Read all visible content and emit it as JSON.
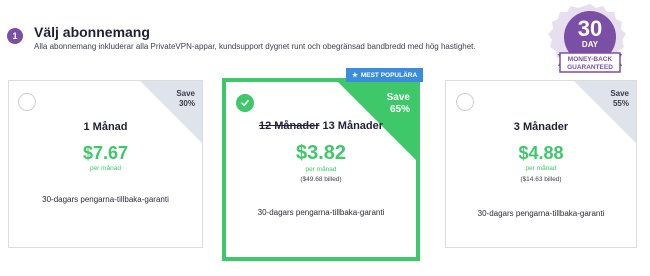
{
  "step": {
    "number": "1",
    "title": "Välj abonnemang",
    "subtitle": "Alla abonnemang inkluderar alla PrivateVPN-appar, kundsupport dygnet runt och obegränsad bandbredd med hög hastighet."
  },
  "seal": {
    "days": "30",
    "unit": "DAY",
    "line1": "MONEY-BACK",
    "line2": "GUARANTEED"
  },
  "popular_badge": "MEST POPULÄRA",
  "plans": [
    {
      "save_word": "Save",
      "save_pct": "30%",
      "old_name": "",
      "name": "1 Månad",
      "price": "$7.67",
      "per": "per månad",
      "billed": "",
      "guarantee": "30-dagars pengarna-tillbaka-garanti"
    },
    {
      "save_word": "Save",
      "save_pct": "65%",
      "old_name": "12 Månader",
      "name": "13 Månader",
      "price": "$3.82",
      "per": "per månad",
      "billed": "($49.68 billed)",
      "guarantee": "30-dagars pengarna-tillbaka-garanti"
    },
    {
      "save_word": "Save",
      "save_pct": "55%",
      "old_name": "",
      "name": "3 Månader",
      "price": "$4.88",
      "per": "per månad",
      "billed": "($14.63 billed)",
      "guarantee": "30-dagars pengarna-tillbaka-garanti"
    }
  ],
  "colors": {
    "accent_green": "#3ec86a",
    "purple": "#7b4fa6",
    "badge_blue": "#3b8ddb"
  }
}
